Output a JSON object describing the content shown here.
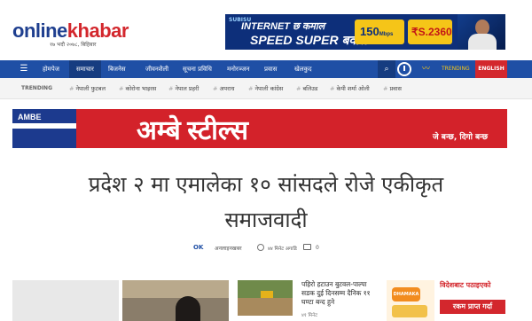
{
  "header": {
    "logo_online": "online",
    "logo_khabar": "khabar",
    "date": "१७ भदौ २०७८, बिहिबार",
    "ad": {
      "brand": "SUBISU",
      "line1": "INTERNET छ कमाल",
      "line2": "SPEED SUPER बवाल",
      "speed": "150",
      "speed_unit": "Mbps",
      "price": "₹S.2360"
    }
  },
  "nav": {
    "items": [
      "होमपेज",
      "समाचार",
      "बिजनेस",
      "जीवनशैली",
      "सूचना प्रविधि",
      "मनोरञ्जन",
      "प्रवास",
      "खेलकुद"
    ],
    "trending": "TRENDING",
    "english": "ENGLISH",
    "colors": {
      "nav_bg": "#1f4fa5",
      "accent": "#d3272d"
    }
  },
  "trending_bar": {
    "label": "TRENDING",
    "items": [
      "नेपाली फुटबल",
      "कोरोना भाइरस",
      "नेपाल प्रहरी",
      "अपराध",
      "नेपाली कांग्रेस",
      "बलिउड",
      "केपी शर्मा ओली",
      "प्रवास"
    ]
  },
  "banner": {
    "brand": "AMBE",
    "title": "अम्बे स्टील्स",
    "tagline": "जे बन्छ, दिगो बन्छ"
  },
  "article": {
    "headline": "प्रदेश २ मा एमालेका १० सांसदले रोजे एकीकृत समाजवादी",
    "author_logo": "OK",
    "author": "अनलाइनखबर",
    "time": "४४ मिनेट अगाडि",
    "comments": "0"
  },
  "cards": {
    "story_title": "पहिरो हटाउन बुटवल-पाल्पा सडक दुई दिनसम्म दैनिक ११ घण्टा बन्द हुने",
    "story_time": "४१ मिनेट",
    "promo_badge": "DHAMAKA",
    "promo_title": "विदेशबाट पठाइएको",
    "promo_box": "रकम प्राप्त गर्दा"
  }
}
